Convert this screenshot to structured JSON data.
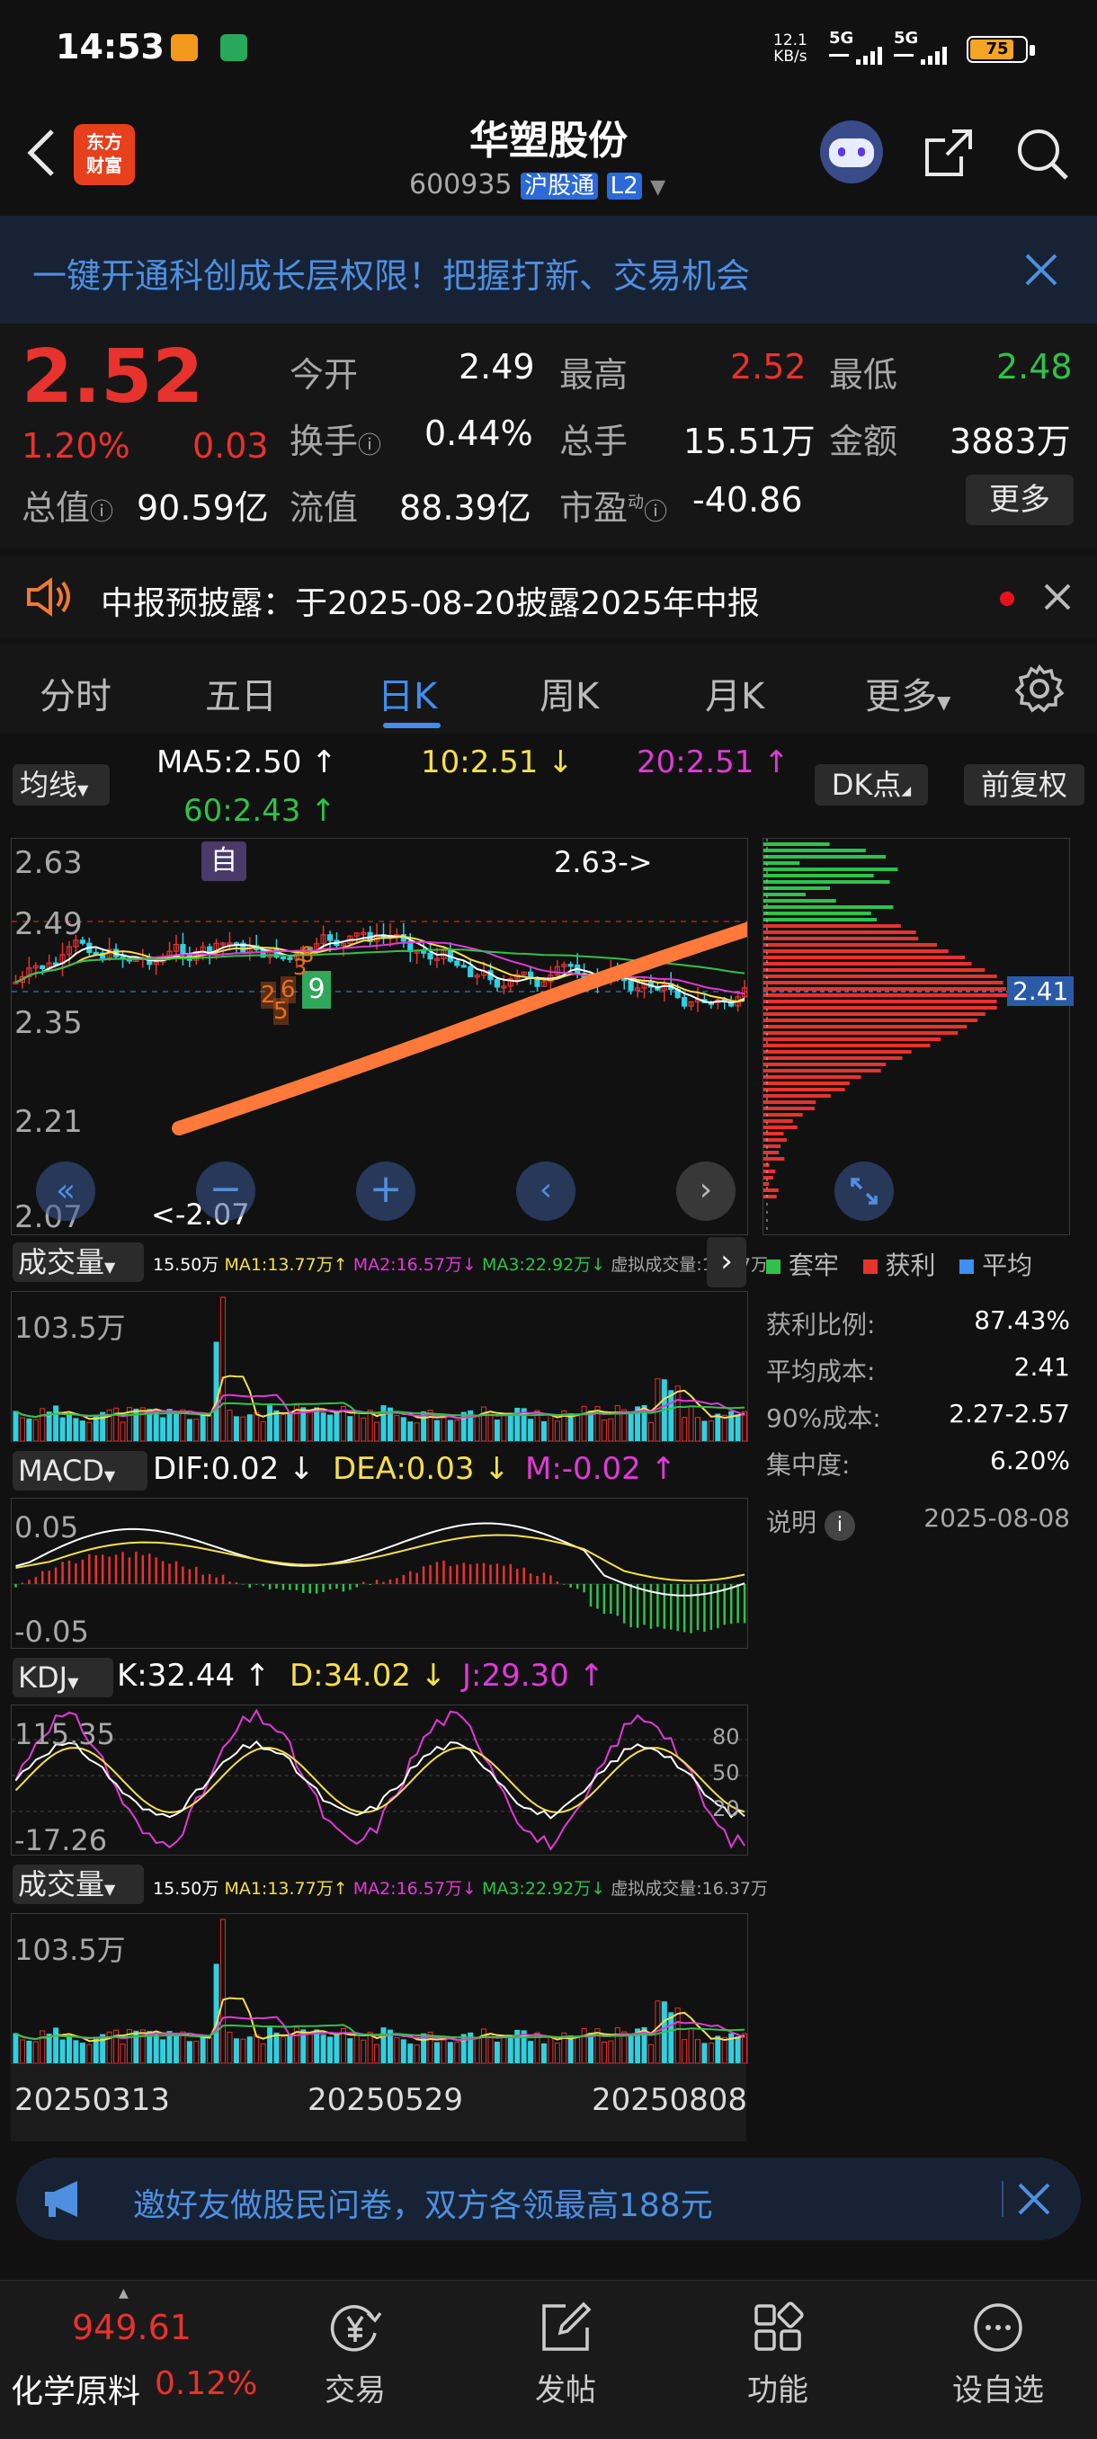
{
  "status_bar": {
    "time": "14:53",
    "net_speed_top": "12.1",
    "net_speed_unit": "KB/s",
    "signal1": "5G",
    "signal2": "5G",
    "battery": "75"
  },
  "header": {
    "logo_line1": "东方",
    "logo_line2": "财富",
    "title": "华塑股份",
    "code": "600935",
    "badge1": "沪股通",
    "badge2": "L2"
  },
  "promo_banner": {
    "text": "一键开通科创成长层权限！把握打新、交易机会"
  },
  "quote": {
    "price": "2.52",
    "change_pct": "1.20%",
    "change": "0.03",
    "open_label": "今开",
    "open": "2.49",
    "high_label": "最高",
    "high": "2.52",
    "low_label": "最低",
    "low": "2.48",
    "turnover_label": "换手",
    "turnover": "0.44%",
    "volume_label": "总手",
    "volume": "15.51万",
    "amount_label": "金额",
    "amount": "3883万",
    "mktcap_label": "总值",
    "mktcap": "90.59亿",
    "float_label": "流值",
    "float": "88.39亿",
    "pe_label": "市盈",
    "pe_sup": "动",
    "pe": "-40.86",
    "more_button": "更多"
  },
  "notice": {
    "text": "中报预披露：于2025-08-20披露2025年中报"
  },
  "tabs": [
    "分时",
    "五日",
    "日K",
    "周K",
    "月K",
    "更多"
  ],
  "active_tab": 2,
  "ma_bar": {
    "selector": "均线",
    "ma5": "MA5:2.50",
    "ma10": "10:2.51",
    "ma20": "20:2.51",
    "ma60": "60:2.43",
    "dk_button": "DK点",
    "adjust_button": "前复权"
  },
  "kline": {
    "y_labels": [
      "2.63",
      "2.49",
      "2.35",
      "2.21",
      "2.07"
    ],
    "max_label": "2.63",
    "min_label": "2.07",
    "self_tag": "自",
    "orange_tag_1": "8",
    "orange_tag_2": "9",
    "orange_tag_3": "2",
    "orange_tag_4": "5",
    "orange_tag_5": "6",
    "orange_tag_6": "3"
  },
  "chip": {
    "current_label": "2.41",
    "legend": [
      "套牢",
      "获利",
      "平均"
    ],
    "rows": [
      {
        "label": "获利比例:",
        "value": "87.43%"
      },
      {
        "label": "平均成本:",
        "value": "2.41"
      },
      {
        "label": "90%成本:",
        "value": "2.27-2.57"
      },
      {
        "label": "集中度:",
        "value": "6.20%"
      }
    ],
    "note_label": "说明",
    "note_date": "2025-08-08"
  },
  "volume1": {
    "selector": "成交量",
    "summary": "15.50万",
    "ma1": "MA1:13.77万",
    "ma2": "MA2:16.57万",
    "ma3": "MA3:22.92万",
    "virtual": "虚拟成交量:16.37万",
    "y_label": "103.5万"
  },
  "macd": {
    "selector": "MACD",
    "dif": "DIF:0.02",
    "dea": "DEA:0.03",
    "m": "M:-0.02",
    "y_top": "0.05",
    "y_bottom": "-0.05"
  },
  "kdj": {
    "selector": "KDJ",
    "k": "K:32.44",
    "d": "D:34.02",
    "j": "J:29.30",
    "y_top": "115.35",
    "y_bottom": "-17.26",
    "r80": "80",
    "r50": "50",
    "r20": "20"
  },
  "volume2": {
    "selector": "成交量",
    "summary": "15.50万",
    "ma1": "MA1:13.77万",
    "ma2": "MA2:16.57万",
    "ma3": "MA3:22.92万",
    "virtual": "虚拟成交量:16.37万",
    "y_label": "103.5万"
  },
  "dates": [
    "20250313",
    "20250529",
    "20250808"
  ],
  "survey_banner": {
    "text": "邀好友做股民问卷，双方各领最高188元"
  },
  "bottom_nav": {
    "index_value": "949.61",
    "index_name": "化学原料",
    "index_change": "0.12%",
    "items": [
      "交易",
      "发帖",
      "功能",
      "设自选"
    ]
  },
  "colors": {
    "up": "#e8322e",
    "down": "#2fc24a",
    "accent": "#3f8ff0",
    "bg": "#111111"
  }
}
